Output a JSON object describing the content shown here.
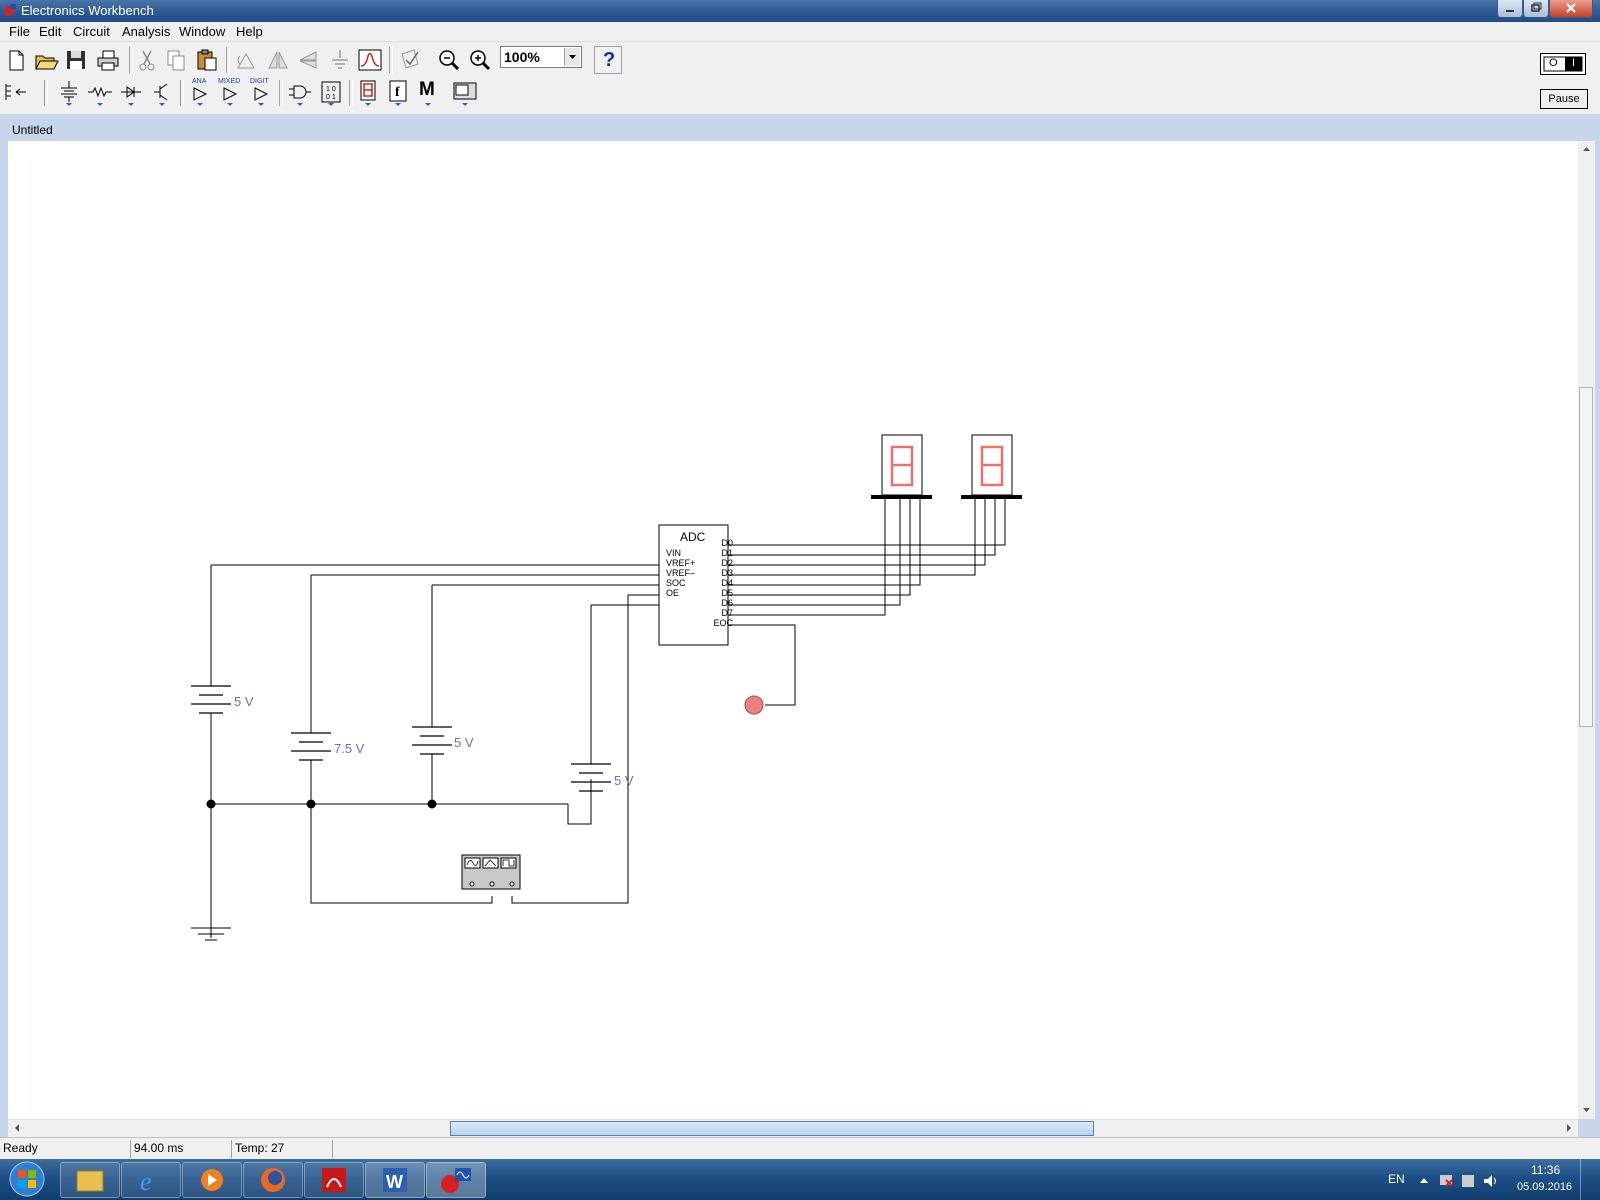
{
  "window": {
    "title": "Electronics Workbench"
  },
  "menu": [
    "File",
    "Edit",
    "Circuit",
    "Analysis",
    "Window",
    "Help"
  ],
  "toolbar": {
    "zoom": "100%",
    "help_label": "?",
    "power_switch": [
      "O",
      "I"
    ],
    "pause_label": "Pause",
    "parts_bins": {
      "analog_ics": "ANA",
      "mixed_ics": "MIXED",
      "digital_ics": "DIGIT",
      "miscellaneous": "M",
      "logic_gates": "D",
      "digital": "f",
      "indicators": "8"
    }
  },
  "document": {
    "title": "Untitled"
  },
  "circuit": {
    "adc": {
      "name": "ADC",
      "left_pins": [
        "VIN",
        "VREF+",
        "VREF–",
        "SOC",
        "OE"
      ],
      "right_pins": [
        "D0",
        "D1",
        "D2",
        "D3",
        "D4",
        "D5",
        "D6",
        "D7",
        "EOC"
      ]
    },
    "batteries": [
      "5 V",
      "7.5 V",
      "5 V",
      "5 V"
    ],
    "displays": [
      "0",
      "0"
    ]
  },
  "status": {
    "state": "Ready",
    "time": "94.00 ms",
    "temp": "Temp:  27"
  },
  "taskbar": {
    "language": "EN",
    "time": "11:36",
    "date": "05.09.2016"
  },
  "colors": {
    "titlebar": "#2f5c96",
    "display_segment": "#e87070",
    "probe": "#f08080",
    "battery_label": "#6a6ac8"
  }
}
